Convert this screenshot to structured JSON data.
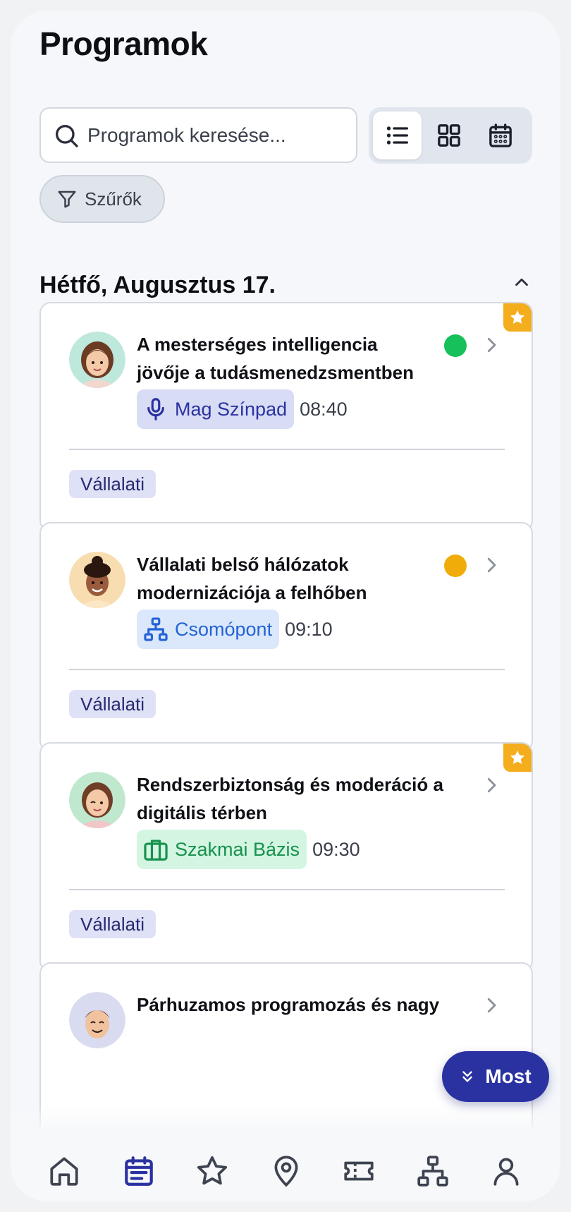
{
  "header": {
    "title": "Programok"
  },
  "search": {
    "placeholder": "Programok keresése..."
  },
  "view_toggle": {
    "options": [
      "list-icon",
      "grid-icon",
      "calendar-icon"
    ],
    "active": "list"
  },
  "filter": {
    "label": "Szűrők"
  },
  "day": {
    "label": "Hétfő, Augusztus 17."
  },
  "colors": {
    "accent": "#2a32a1",
    "favorite": "#f3ad1d",
    "status_green": "#16c05a",
    "status_amber": "#f0ad0a"
  },
  "events": [
    {
      "title_line1": "A mesterséges intelligencia",
      "title_line2": "jövője a tudásmenedzsmentben",
      "location": "Mag Színpad",
      "location_icon": "microphone-icon",
      "time": "08:40",
      "tag": "Vállalati",
      "favorite": true,
      "status": "green"
    },
    {
      "title_line1": "Vállalati belső hálózatok",
      "title_line2": "modernizációja a felhőben",
      "location": "Csomópont",
      "location_icon": "network-icon",
      "time": "09:10",
      "tag": "Vállalati",
      "favorite": false,
      "status": "amber"
    },
    {
      "title_line1": "Rendszerbiztonság és moderáció a",
      "title_line2": "digitális térben",
      "location": "Szakmai Bázis",
      "location_icon": "briefcase-icon",
      "time": "09:30",
      "tag": "Vállalati",
      "favorite": true,
      "status": "none"
    },
    {
      "title_line1": "Párhuzamos programozás és nagy",
      "title_line2": "",
      "location": "",
      "time": "",
      "tag": "",
      "favorite": false,
      "status": "none"
    }
  ],
  "now_button": {
    "label": "Most"
  },
  "tabbar": {
    "items": [
      "home-icon",
      "calendar-icon",
      "star-icon",
      "map-pin-icon",
      "ticket-icon",
      "network-icon",
      "user-icon"
    ],
    "active": "calendar-icon"
  }
}
